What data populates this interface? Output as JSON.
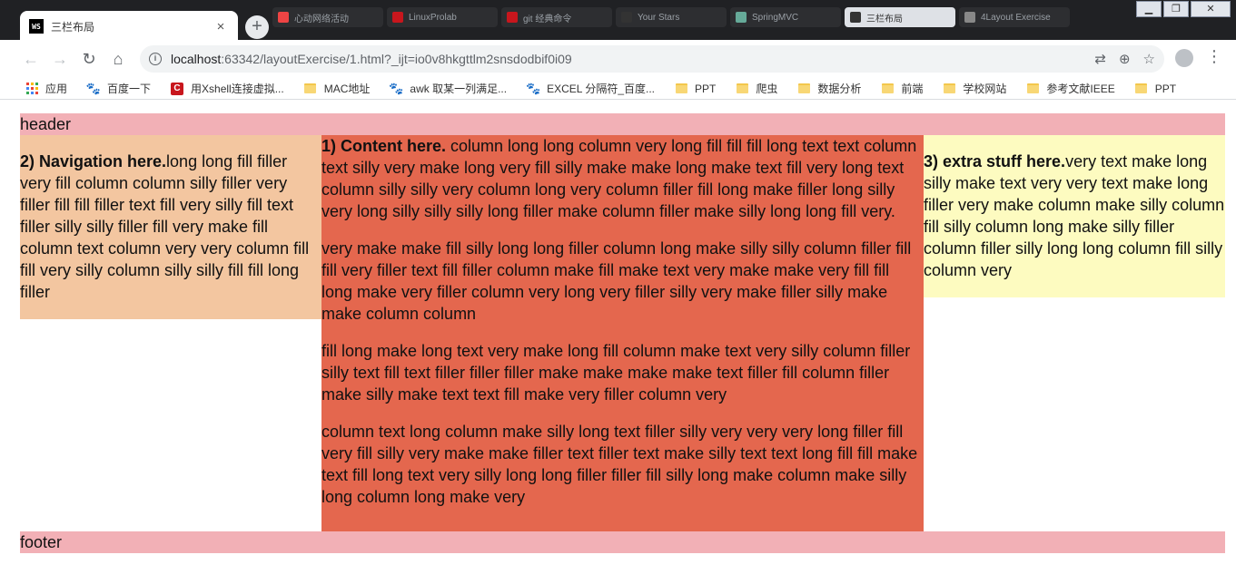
{
  "browser": {
    "active_tab": {
      "title": "三栏布局",
      "close": "×"
    },
    "background_tabs": [
      "心动网络活动",
      "LinuxProlab",
      "git 经典命令",
      "Your Stars",
      "SpringMVC",
      "三栏布局",
      "4Layout Exercise"
    ],
    "new_tab": "+",
    "url_host": "localhost",
    "url_rest": ":63342/layoutExercise/1.html?_ijt=io0v8hkgttlm2snsdodbif0i09",
    "nav_icons": {
      "back": "←",
      "forward": "→",
      "reload": "↻",
      "home": "⌂"
    }
  },
  "bookmarks": [
    {
      "label": "应用",
      "icon": "apps-grid-icon"
    },
    {
      "label": "百度一下",
      "icon": "baidu-paw-icon"
    },
    {
      "label": "用Xshell连接虚拟...",
      "icon": "csdn-icon"
    },
    {
      "label": "MAC地址",
      "icon": "folder-icon"
    },
    {
      "label": "awk 取某一列满足...",
      "icon": "baidu-paw-icon"
    },
    {
      "label": "EXCEL 分隔符_百度...",
      "icon": "baidu-paw-icon"
    },
    {
      "label": "PPT",
      "icon": "folder-icon"
    },
    {
      "label": "爬虫",
      "icon": "folder-icon"
    },
    {
      "label": "数据分析",
      "icon": "folder-icon"
    },
    {
      "label": "前端",
      "icon": "folder-icon"
    },
    {
      "label": "学校网站",
      "icon": "folder-icon"
    },
    {
      "label": "参考文献IEEE",
      "icon": "folder-icon"
    },
    {
      "label": "PPT",
      "icon": "folder-icon"
    }
  ],
  "page": {
    "header": "header",
    "nav": {
      "heading": "2) Navigation here.",
      "text": "long long fill filler very fill column column silly filler very filler fill fill filler text fill very silly fill text filler silly silly filler fill very make fill column text column very very column fill fill very silly column silly silly fill fill long filler"
    },
    "content": {
      "heading": "1) Content here.",
      "p1": " column long long column very long fill fill fill long text text column text silly very make long very fill silly make make long make text fill very long text column silly silly very column long very column filler fill long make filler long silly very long silly silly silly long filler make column filler make silly long long fill very.",
      "p2": "very make make fill silly long long filler column long make silly silly column filler fill fill very filler text fill filler column make fill make text very make make very fill fill long make very filler column very long very filler silly very make filler silly make make column column",
      "p3": "fill long make long text very make long fill column make text very silly column filler silly text fill text filler filler filler make make make make text filler fill column filler make silly make text text fill make very filler column very",
      "p4": "column text long column make silly long text filler silly very very very long filler fill very fill silly very make make filler text filler text make silly text text long fill fill make text fill long text very silly long long filler filler fill silly long make column make silly long column long make very"
    },
    "extra": {
      "heading": "3) extra stuff here.",
      "text": "very text make long silly make text very very text make long filler very make column make silly column fill silly column long make silly filler column filler silly long long column fill silly column very"
    },
    "footer": "footer"
  },
  "colors": {
    "header_footer": "#f2b0b6",
    "nav": "#f3c6a0",
    "content": "#e4674e",
    "extra": "#fdfbc0"
  }
}
